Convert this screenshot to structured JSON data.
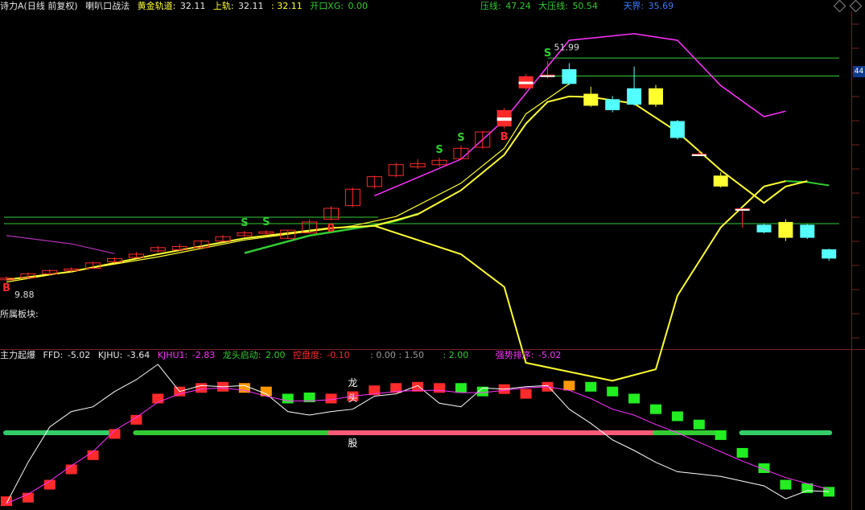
{
  "header": {
    "stock": "诗力A(日线 前复权)",
    "indicator": "喇叭口战法",
    "gold_track_label": "黄金轨道:",
    "gold_track_value": "32.11",
    "upper_label": "上轨:",
    "upper_value": "32.11",
    "sep_value": ": 32.11",
    "open_label": "开口XG:",
    "open_value": "0.00",
    "pressure_label": "压线:",
    "pressure_value": "47.24",
    "big_pressure_label": "大压线:",
    "big_pressure_value": "50.54",
    "sky_label": "天界:",
    "sky_value": "35.69"
  },
  "main_panel": {
    "sector_label": "所属板块:",
    "right_tag": "44",
    "high_label": "51.99",
    "low_label": "9.88"
  },
  "sub_header": {
    "name": "主力起爆",
    "ffd_label": "FFD:",
    "ffd_value": "-5.02",
    "kjhu_label": "KJHU:",
    "kjhu_value": "-3.64",
    "kjhu1_label": "KJHU1:",
    "kjhu1_value": "-2.83",
    "dragon_label": "龙头启动:",
    "dragon_value": "2.00",
    "control_label": "控盘度:",
    "control_value": "-0.10",
    "misc1": ": 0.00 : 1.50",
    "misc2": ": 2.00",
    "strength_label": "强势排序:",
    "strength_value": "-5.02"
  },
  "colors": {
    "up": "#ff2a2a",
    "down_cyan": "#54ffff",
    "yellow": "#ffff33",
    "magenta": "#ff33ff",
    "green": "#33cc33",
    "pink_band": "#ff5a78",
    "orange": "#ff9900",
    "white": "#ffffff"
  },
  "chart_data": [
    {
      "type": "candlestick",
      "title": "喇叭口战法",
      "ylim": [
        0,
        60
      ],
      "x": [
        1,
        2,
        3,
        4,
        5,
        6,
        7,
        8,
        9,
        10,
        11,
        12,
        13,
        14,
        15,
        16,
        17,
        18,
        19,
        20,
        21,
        22,
        23,
        24,
        25,
        26,
        27,
        28,
        29,
        30,
        31,
        32,
        33,
        34,
        35,
        36,
        37,
        38,
        39
      ],
      "ohlc": [
        [
          10.0,
          10.5,
          9.88,
          10.2
        ],
        [
          10.3,
          11.2,
          10.1,
          11.0
        ],
        [
          11.0,
          11.8,
          10.8,
          11.6
        ],
        [
          11.6,
          12.2,
          11.3,
          11.9
        ],
        [
          12.0,
          13.2,
          11.9,
          13.0
        ],
        [
          13.2,
          14.0,
          13.0,
          13.8
        ],
        [
          14.0,
          15.0,
          13.9,
          14.6
        ],
        [
          15.2,
          16.1,
          14.9,
          15.8
        ],
        [
          16.0,
          16.5,
          15.2,
          15.4
        ],
        [
          15.8,
          17.2,
          15.6,
          17.0
        ],
        [
          17.0,
          18.1,
          16.9,
          17.8
        ],
        [
          18.0,
          18.9,
          17.8,
          18.5
        ],
        [
          18.6,
          19.0,
          18.0,
          18.7
        ],
        [
          17.5,
          19.1,
          17.4,
          19.0
        ],
        [
          18.5,
          21.0,
          18.4,
          20.5
        ],
        [
          21.0,
          23.4,
          20.8,
          23.0
        ],
        [
          23.5,
          26.8,
          23.2,
          26.5
        ],
        [
          27.0,
          29.0,
          26.6,
          28.8
        ],
        [
          29.0,
          31.4,
          28.7,
          31.0
        ],
        [
          31.2,
          32.0,
          30.2,
          30.6
        ],
        [
          31.0,
          32.3,
          30.6,
          31.8
        ],
        [
          32.1,
          34.5,
          31.8,
          34.0
        ],
        [
          34.2,
          37.2,
          33.9,
          37.0
        ],
        [
          38.0,
          41.4,
          37.6,
          41.0
        ],
        [
          45.0,
          47.6,
          44.6,
          47.2
        ],
        [
          47.2,
          50.0,
          46.8,
          47.5
        ],
        [
          48.5,
          49.6,
          45.6,
          45.8
        ],
        [
          44.0,
          45.3,
          41.6,
          41.8
        ],
        [
          43.0,
          43.6,
          40.6,
          41.0
        ],
        [
          45.0,
          49.0,
          41.8,
          42.0
        ],
        [
          45.0,
          45.6,
          41.6,
          42.0
        ],
        [
          39.0,
          39.2,
          35.6,
          35.9
        ],
        [
          33.0,
          33.6,
          32.6,
          33.0
        ],
        [
          29.0,
          29.6,
          26.8,
          27.0
        ],
        [
          23.0,
          23.0,
          19.5,
          23.0
        ],
        [
          20.0,
          20.2,
          18.4,
          18.6
        ],
        [
          20.5,
          21.0,
          17.0,
          17.6
        ],
        [
          20.0,
          20.1,
          17.4,
          17.6
        ],
        [
          15.5,
          15.6,
          13.4,
          13.8
        ]
      ],
      "lines": [
        {
          "role": "gold_track",
          "color": "#33cc33",
          "points": [
            [
              12,
              14.8
            ],
            [
              15,
              18.0
            ],
            [
              18,
              19.9
            ],
            [
              19,
              20.7
            ],
            [
              20,
              22.0
            ]
          ]
        },
        {
          "role": "gold_track_late",
          "color": "#33cc33",
          "points": [
            [
              37,
              28.0
            ],
            [
              38,
              27.8
            ],
            [
              39,
              27.2
            ]
          ]
        },
        {
          "role": "upper_yellow",
          "points": [
            [
              1,
              9.9
            ],
            [
              4,
              11.4
            ],
            [
              8,
              14.6
            ],
            [
              12,
              17.5
            ],
            [
              16,
              19.4
            ],
            [
              18,
              19.8
            ],
            [
              20,
              21.9
            ],
            [
              22,
              26.3
            ],
            [
              24,
              32.8
            ],
            [
              25,
              38.5
            ],
            [
              26,
              42.5
            ],
            [
              27,
              43.5
            ],
            [
              28,
              43.4
            ],
            [
              30,
              42.2
            ],
            [
              32,
              37.0
            ],
            [
              34,
              30.0
            ],
            [
              36,
              24.0
            ],
            [
              37,
              27.0
            ],
            [
              38,
              28.0
            ]
          ]
        },
        {
          "role": "mid_yellow",
          "points": [
            [
              1,
              9.5
            ],
            [
              8,
              14.1
            ],
            [
              12,
              17.2
            ],
            [
              17,
              19.8
            ],
            [
              19,
              21.5
            ],
            [
              22,
              27.6
            ],
            [
              24,
              34.0
            ],
            [
              25,
              40.3
            ],
            [
              27,
              45.8
            ]
          ]
        },
        {
          "role": "lower_yellow",
          "points": [
            [
              18,
              19.8
            ],
            [
              22,
              14.6
            ],
            [
              24,
              8.6
            ],
            [
              25,
              -5.3
            ],
            [
              29,
              -8.6
            ],
            [
              31,
              -6.5
            ],
            [
              32,
              7.0
            ],
            [
              34,
              19.5
            ],
            [
              36,
              27.0
            ],
            [
              37,
              28.0
            ]
          ]
        },
        {
          "role": "magenta_upper",
          "points": [
            [
              18,
              25.3
            ],
            [
              22,
              32.0
            ],
            [
              24,
              39.2
            ],
            [
              26,
              49.0
            ],
            [
              27,
              53.8
            ],
            [
              30,
              55.0
            ],
            [
              32,
              53.8
            ],
            [
              34,
              45.5
            ],
            [
              36,
              39.8
            ],
            [
              37,
              40.8
            ]
          ]
        },
        {
          "role": "magenta_left",
          "points": [
            [
              1,
              18.0
            ],
            [
              4,
              16.5
            ],
            [
              6,
              14.7
            ]
          ]
        },
        {
          "role": "pressure",
          "value": 47.24
        },
        {
          "role": "big_pressure",
          "value": 50.54
        },
        {
          "role": "sky",
          "value": 20.2
        }
      ],
      "signals": [
        {
          "x": 12,
          "text": "S",
          "color": "#33cc33"
        },
        {
          "x": 13,
          "text": "S",
          "color": "#33cc33"
        },
        {
          "x": 16,
          "text": "B",
          "color": "#ff2a2a"
        },
        {
          "x": 21,
          "text": "S",
          "color": "#33cc33"
        },
        {
          "x": 22,
          "text": "S",
          "color": "#33cc33"
        },
        {
          "x": 24,
          "text": "B",
          "color": "#ff2a2a"
        },
        {
          "x": 26,
          "text": "S",
          "color": "#33cc33"
        },
        {
          "x": 1,
          "text": "B",
          "color": "#ff2a2a"
        }
      ]
    },
    {
      "type": "bar",
      "title": "主力起爆",
      "ylim": [
        -6,
        6
      ],
      "x": [
        1,
        2,
        3,
        4,
        5,
        6,
        7,
        8,
        9,
        10,
        11,
        12,
        13,
        14,
        15,
        16,
        17,
        18,
        19,
        20,
        21,
        22,
        23,
        24,
        25,
        26,
        27,
        28,
        29,
        30,
        31,
        32,
        33,
        34,
        35,
        36,
        37,
        38,
        39
      ],
      "values": [
        -5.8,
        -5.5,
        -4.4,
        -3.1,
        -1.9,
        -0.1,
        1.1,
        2.9,
        3.5,
        3.8,
        3.9,
        3.8,
        3.5,
        2.9,
        3.0,
        2.9,
        3.1,
        3.6,
        3.8,
        3.9,
        3.8,
        3.8,
        3.5,
        3.7,
        3.3,
        3.9,
        4.0,
        3.9,
        3.5,
        2.9,
        2.0,
        1.4,
        0.7,
        -0.2,
        -1.7,
        -3.0,
        -4.4,
        -4.7,
        -5.0
      ],
      "colors": [
        "r",
        "r",
        "r",
        "r",
        "r",
        "r",
        "r",
        "r",
        "r",
        "r",
        "r",
        "o",
        "o",
        "g",
        "g",
        "r",
        "r",
        "r",
        "r",
        "r",
        "r",
        "g",
        "g",
        "r",
        "r",
        "r",
        "o",
        "g",
        "g",
        "g",
        "g",
        "g",
        "g",
        "g",
        "g",
        "g",
        "g",
        "g",
        "g"
      ],
      "series": [
        {
          "name": "FFD",
          "color": "#ffffff",
          "values": [
            -6.0,
            -2.5,
            0.5,
            1.8,
            2.2,
            3.5,
            4.5,
            5.8,
            3.5,
            4.0,
            3.9,
            4.0,
            3.3,
            1.8,
            1.5,
            1.8,
            2.0,
            3.1,
            3.3,
            4.0,
            2.5,
            2.2,
            3.8,
            3.7,
            3.9,
            4.0,
            2.0,
            0.8,
            -0.6,
            -1.5,
            -2.5,
            -3.3,
            -3.5,
            -3.7,
            -4.1,
            -4.5,
            -5.6,
            -4.9,
            -5.0
          ]
        },
        {
          "name": "KJHU",
          "color": "#ff33ff",
          "values": [
            -6.0,
            -5.2,
            -4.1,
            -2.8,
            -1.6,
            0.2,
            1.3,
            2.6,
            3.3,
            3.7,
            3.8,
            3.6,
            3.1,
            2.7,
            2.7,
            2.8,
            3.1,
            3.3,
            3.5,
            3.6,
            3.6,
            3.4,
            3.4,
            3.6,
            3.8,
            3.9,
            3.6,
            2.9,
            2.0,
            1.5,
            0.7,
            0.0,
            -0.8,
            -1.6,
            -2.4,
            -3.1,
            -3.8,
            -4.3,
            -4.8
          ]
        }
      ],
      "bands": {
        "green_left": [
          1,
          6
        ],
        "green_mid": [
          7,
          16
        ],
        "pink": [
          16,
          31
        ],
        "green_right": [
          31,
          34
        ],
        "green_far": [
          35,
          39
        ]
      },
      "text_marks": [
        "龙",
        "头",
        "股"
      ]
    }
  ]
}
